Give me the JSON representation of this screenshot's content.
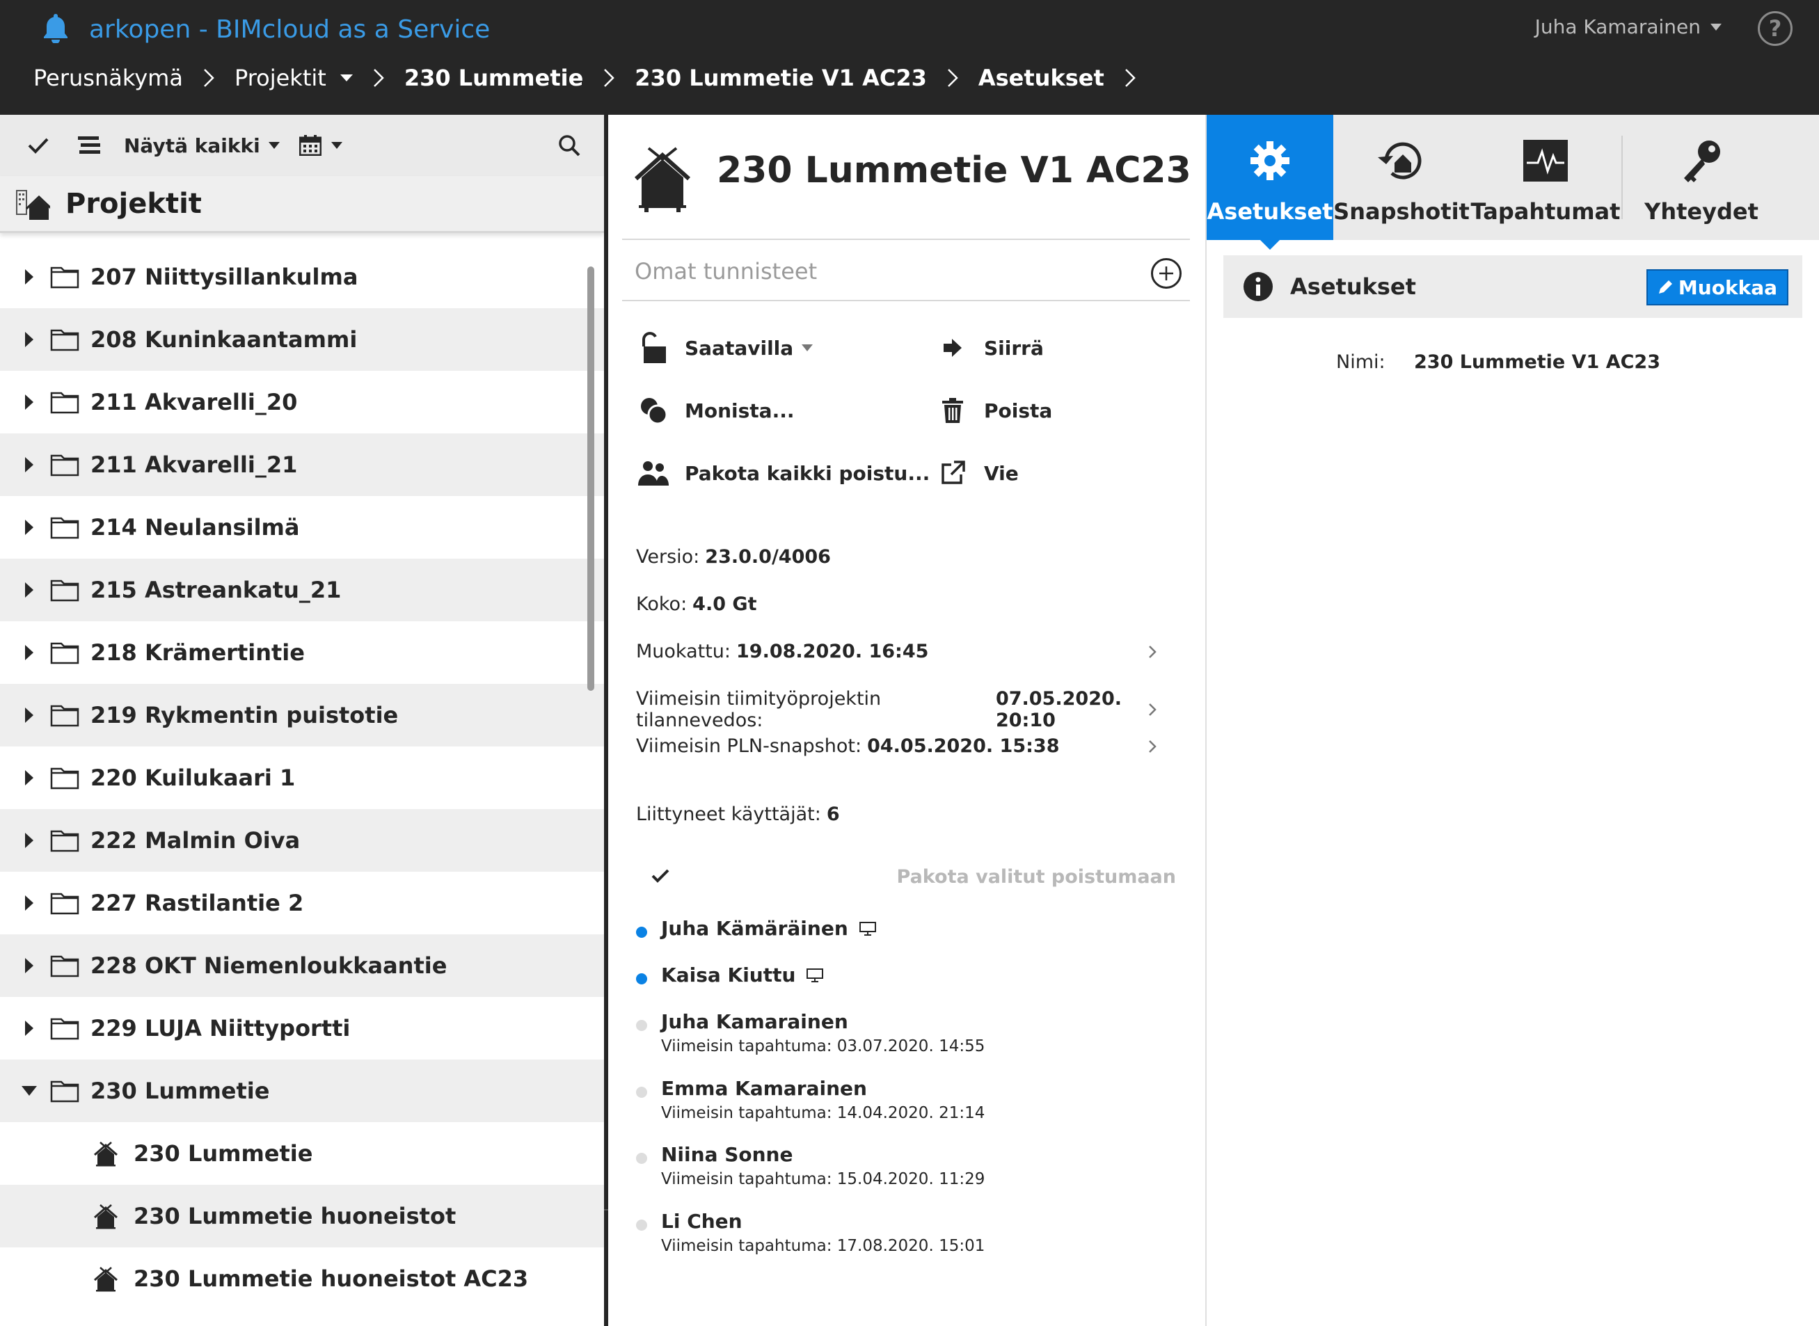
{
  "header": {
    "app_title": "arkopen - BIMcloud as a Service",
    "user_name": "Juha Kamarainen",
    "help_label": "?"
  },
  "breadcrumb": [
    {
      "label": "Perusnäkymä",
      "bold": false,
      "dropdown": false
    },
    {
      "label": "Projektit",
      "bold": false,
      "dropdown": true
    },
    {
      "label": "230 Lummetie",
      "bold": true,
      "dropdown": false
    },
    {
      "label": "230 Lummetie V1 AC23",
      "bold": true,
      "dropdown": false
    },
    {
      "label": "Asetukset",
      "bold": true,
      "dropdown": false
    }
  ],
  "left_panel": {
    "filter_label": "Näytä kaikki",
    "title": "Projektit",
    "tree": [
      {
        "label": "207 Niittysillankulma",
        "type": "folder",
        "expanded": false
      },
      {
        "label": "208 Kuninkaantammi",
        "type": "folder",
        "expanded": false
      },
      {
        "label": "211 Akvarelli_20",
        "type": "folder",
        "expanded": false
      },
      {
        "label": "211 Akvarelli_21",
        "type": "folder",
        "expanded": false
      },
      {
        "label": "214 Neulansilmä",
        "type": "folder",
        "expanded": false
      },
      {
        "label": "215 Astreankatu_21",
        "type": "folder",
        "expanded": false
      },
      {
        "label": "218 Krämertintie",
        "type": "folder",
        "expanded": false
      },
      {
        "label": "219 Rykmentin puistotie",
        "type": "folder",
        "expanded": false
      },
      {
        "label": "220 Kuilukaari 1",
        "type": "folder",
        "expanded": false
      },
      {
        "label": "222 Malmin Oiva",
        "type": "folder",
        "expanded": false
      },
      {
        "label": "227 Rastilantie 2",
        "type": "folder",
        "expanded": false
      },
      {
        "label": "228 OKT Niemenloukkaantie",
        "type": "folder",
        "expanded": false
      },
      {
        "label": "229 LUJA Niittyportti",
        "type": "folder",
        "expanded": false
      },
      {
        "label": "230 Lummetie",
        "type": "folder",
        "expanded": true
      },
      {
        "label": "230 Lummetie",
        "type": "project",
        "expanded": false
      },
      {
        "label": "230 Lummetie huoneistot",
        "type": "project",
        "expanded": false
      },
      {
        "label": "230 Lummetie huoneistot AC23",
        "type": "project",
        "expanded": false
      }
    ]
  },
  "project": {
    "title": "230 Lummetie V1 AC23",
    "tags_placeholder": "Omat tunnisteet",
    "actions": {
      "available": "Saatavilla",
      "move": "Siirrä",
      "duplicate": "Monista...",
      "delete": "Poista",
      "force_all": "Pakota kaikki poistu...",
      "export": "Vie"
    },
    "info": {
      "version_label": "Versio:",
      "version_value": "23.0.0/4006",
      "size_label": "Koko:",
      "size_value": "4.0 Gt",
      "modified_label": "Muokattu:",
      "modified_value": "19.08.2020. 16:45",
      "teamwork_label": "Viimeisin tiimityöprojektin tilannevedos:",
      "teamwork_value": "07.05.2020. 20:10",
      "pln_label": "Viimeisin PLN-snapshot:",
      "pln_value": "04.05.2020. 15:38",
      "users_label": "Liittyneet käyttäjät:",
      "users_value": "6"
    },
    "force_selected": "Pakota valitut poistumaan",
    "users": [
      {
        "name": "Juha Kämäräinen",
        "online": true,
        "last": ""
      },
      {
        "name": "Kaisa Kiuttu",
        "online": true,
        "last": ""
      },
      {
        "name": "Juha Kamarainen",
        "online": false,
        "last": "Viimeisin tapahtuma: 03.07.2020. 14:55"
      },
      {
        "name": "Emma Kamarainen",
        "online": false,
        "last": "Viimeisin tapahtuma: 14.04.2020. 21:14"
      },
      {
        "name": "Niina Sonne",
        "online": false,
        "last": "Viimeisin tapahtuma: 15.04.2020. 11:29"
      },
      {
        "name": "Li Chen",
        "online": false,
        "last": "Viimeisin tapahtuma: 17.08.2020. 15:01"
      }
    ]
  },
  "right_panel": {
    "tabs": {
      "settings": "Asetukset",
      "snapshots": "Snapshotit",
      "events": "Tapahtumat",
      "connections": "Yhteydet"
    },
    "section_title": "Asetukset",
    "edit_label": "Muokkaa",
    "name_label": "Nimi:",
    "name_value": "230 Lummetie V1 AC23"
  },
  "colors": {
    "accent": "#0a82e4",
    "header_bg": "#262626",
    "app_title": "#3a9be6",
    "online_dot": "#0a82e4",
    "offline_dot": "#dddddd"
  }
}
